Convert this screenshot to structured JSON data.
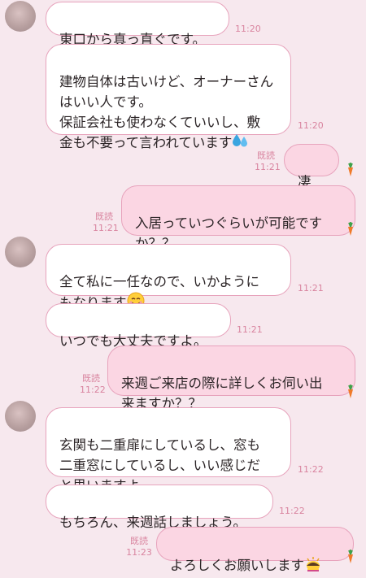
{
  "messages": [
    {
      "side": "in",
      "avatar": true,
      "text": "東口から真っ直ぐです。",
      "time": "11:20"
    },
    {
      "side": "in",
      "avatar": false,
      "text": "建物自体は古いけど、オーナーさん\nはいい人です。\n保証会社も使わなくていいし、敷\n金も不要って言われています",
      "emoji": "sweat-drops-icon",
      "time": "11:20"
    },
    {
      "side": "out",
      "text": "凄い！",
      "read": "既読",
      "time": "11:21"
    },
    {
      "side": "out",
      "text": "入居っていつぐらいが可能です\nか？？",
      "read": "既読",
      "time": "11:21"
    },
    {
      "side": "in",
      "avatar": true,
      "text": "全て私に一任なので、いかように\nもなります",
      "emoji": "smiling-face-icon",
      "time": "11:21"
    },
    {
      "side": "in",
      "avatar": false,
      "text": "いつでも大丈夫ですよ。",
      "time": "11:21"
    },
    {
      "side": "out",
      "text": "来週ご来店の際に詳しくお伺い出\n来ますか？？",
      "read": "既読",
      "time": "11:22"
    },
    {
      "side": "in",
      "avatar": true,
      "text": "玄関も二重扉にしているし、窓も\n二重窓にしているし、いい感じだ\nと思いますよ。",
      "time": "11:22"
    },
    {
      "side": "in",
      "avatar": false,
      "text": "もちろん、来週話しましょう。",
      "time": "11:22"
    },
    {
      "side": "out",
      "text": "よろしくお願いします",
      "emoji": "bowing-person-icon",
      "read": "既読",
      "time": "11:23"
    }
  ],
  "colors": {
    "background": "#f7e8ee",
    "bubble_border": "#e7a3bc",
    "outgoing_bubble": "#fbd6e3",
    "timestamp": "#d9849f"
  }
}
